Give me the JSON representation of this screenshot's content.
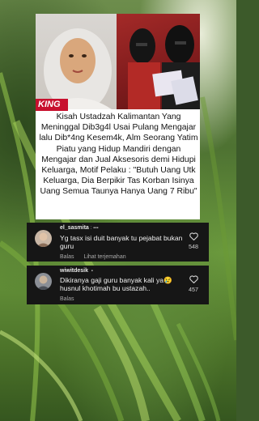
{
  "news_card": {
    "banner": "KING",
    "headline": "Kisah Ustadzah Kalimantan Yang Meninggal Dib3g4l Usai Pulang Mengajar lalu Dib*4ng Kesem4k, Alm Seorang Yatim Piatu yang Hidup Mandiri dengan Mengajar dan Jual Aksesoris demi Hidupi Keluarga, Motif Pelaku : \"Butuh Uang Utk Keluarga, Dia Berpikir Tas Korban Isinya Uang Semua Taunya Hanya Uang 7 Ribu\""
  },
  "comments": [
    {
      "username": "el_sasmita",
      "flag": "🇲🇾",
      "text": "Yg tasx isi duit banyak tu pejabat bukan guru",
      "reply_label": "Balas",
      "translate_label": "Lihat terjemahan",
      "likes": "548"
    },
    {
      "username": "wiwitdesik",
      "flag": "🇮🇩",
      "text": "Dikiranya gaji guru banyak kali ya😢 husnul khotimah bu ustazah..",
      "reply_label": "Balas",
      "likes": "457"
    }
  ],
  "colors": {
    "comment_bg": "#161616",
    "banner_red": "#c8102e"
  },
  "icons": [
    "heart-outline-icon"
  ]
}
